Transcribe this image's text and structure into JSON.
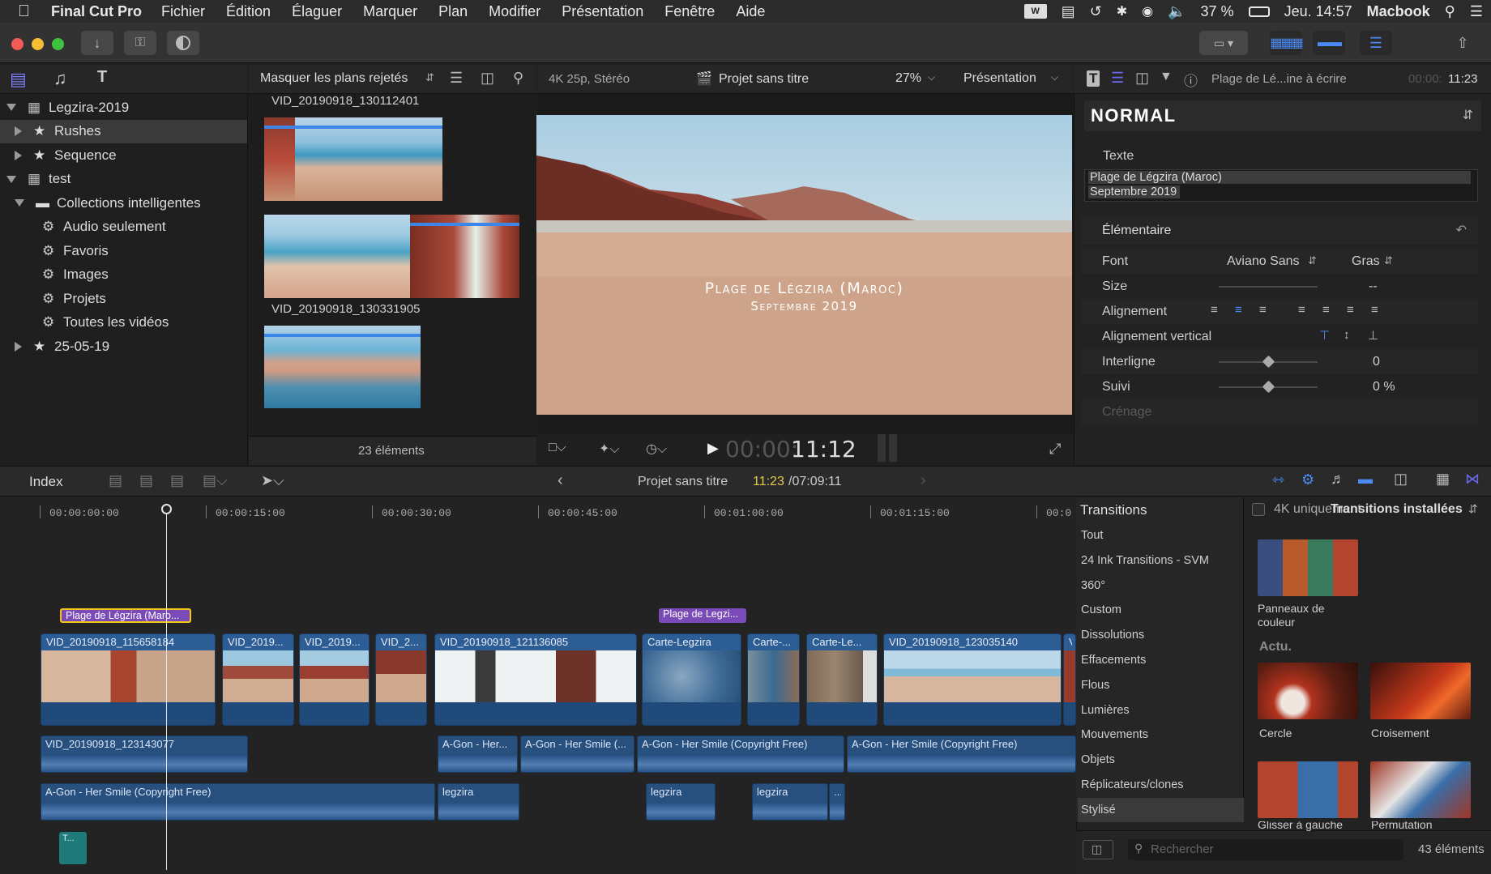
{
  "menubar": {
    "app": "Final Cut Pro",
    "items": [
      "Fichier",
      "Édition",
      "Élaguer",
      "Marquer",
      "Plan",
      "Modifier",
      "Présentation",
      "Fenêtre",
      "Aide"
    ],
    "battery": "37 %",
    "clock": "Jeu. 14:57",
    "user": "Macbook"
  },
  "library": {
    "items": [
      {
        "label": "Legzira-2019",
        "icon": "library-icon",
        "expanded": true
      },
      {
        "label": "Rushes",
        "icon": "event-star-icon",
        "expanded": false,
        "selected": true
      },
      {
        "label": "Sequence",
        "icon": "event-star-icon",
        "expanded": false
      },
      {
        "label": "test",
        "icon": "library-icon",
        "expanded": true
      },
      {
        "label": "Collections intelligentes",
        "icon": "folder-icon",
        "expanded": true
      },
      {
        "label": "Audio seulement",
        "icon": "gear-icon"
      },
      {
        "label": "Favoris",
        "icon": "gear-icon"
      },
      {
        "label": "Images",
        "icon": "gear-icon"
      },
      {
        "label": "Projets",
        "icon": "gear-icon"
      },
      {
        "label": "Toutes les vidéos",
        "icon": "gear-icon"
      },
      {
        "label": "25-05-19",
        "icon": "event-star-icon",
        "expanded": false
      }
    ]
  },
  "browser": {
    "filter": "Masquer les plans rejetés",
    "clip1_name": "VID_20190918_130112401",
    "clip2_name": "VID_20190918_130331905",
    "count": "23 éléments"
  },
  "viewer": {
    "format": "4K 25p, Stéréo",
    "project": "Projet sans titre",
    "zoom": "27%",
    "presentation": "Présentation",
    "title_line1": "Plage de Légzira (Maroc)",
    "title_line2": "Septembre 2019",
    "timecode_dim": "00:00:",
    "timecode": "11:12"
  },
  "inspector": {
    "clip_name": "Plage de Lé...ine à écrire",
    "time_dim": "00:00:",
    "time": "11:23",
    "preset": "NORMAL",
    "text_section": "Texte",
    "text_line1": "Plage de Légzira (Maroc)",
    "text_line2": "Septembre 2019",
    "basic_section": "Élémentaire",
    "font_label": "Font",
    "font_value": "Aviano Sans",
    "font_weight": "Gras",
    "size_label": "Size",
    "size_value": "--",
    "align_label": "Alignement",
    "valign_label": "Alignement vertical",
    "leading_label": "Interligne",
    "leading_value": "0",
    "tracking_label": "Suivi",
    "tracking_value": "0 %",
    "kerning_label": "Crénage"
  },
  "timeline_bar": {
    "index": "Index",
    "project": "Projet sans titre",
    "position": "11:23",
    "duration": "/07:09:11"
  },
  "ruler": [
    "00:00:00:00",
    "00:00:15:00",
    "00:00:30:00",
    "00:00:45:00",
    "00:01:00:00",
    "00:01:15:00",
    "00:0"
  ],
  "titles": [
    "Plage de Légzira (Maro...",
    "Plage de Legzi..."
  ],
  "clips": [
    "VID_20190918_115658184",
    "VID_2019...",
    "VID_2019...",
    "VID_2...",
    "VID_20190918_121136085",
    "Carte-Legzira",
    "Carte-...",
    "Carte-Le...",
    "VID_20190918_123035140",
    "V"
  ],
  "audio_row1": [
    "VID_20190918_123143077",
    "A-Gon - Her...",
    "A-Gon - Her Smile (...",
    "A-Gon - Her Smile (Copyright Free)",
    "A-Gon - Her Smile (Copyright Free)"
  ],
  "audio_row2": [
    "A-Gon - Her Smile (Copyright Free)",
    "legzira",
    "legzira",
    "legzira",
    "..."
  ],
  "small_clip": "T...",
  "transitions": {
    "header": "Transitions",
    "filter_4k": "4K uniquement",
    "installed": "Transitions installées",
    "categories": [
      "Tout",
      "24 Ink Transitions - SVM",
      "360°",
      "Custom",
      "Dissolutions",
      "Effacements",
      "Flous",
      "Lumières",
      "Mouvements",
      "Objets",
      "Réplicateurs/clones",
      "Stylisé"
    ],
    "tile1": "Panneaux de couleur",
    "section": "Actu.",
    "tile2": "Cercle",
    "tile3": "Croisement",
    "tile4": "Glisser à gauche",
    "tile5": "Permutation",
    "search_placeholder": "Rechercher",
    "count": "43 éléments"
  },
  "colors": {
    "accent": "#4a8bf5",
    "video_clip": "#2c5d94",
    "title_clip": "#7a4bb8",
    "playhead": "#e6e6e6",
    "timecode_yellow": "#e7c94a"
  }
}
